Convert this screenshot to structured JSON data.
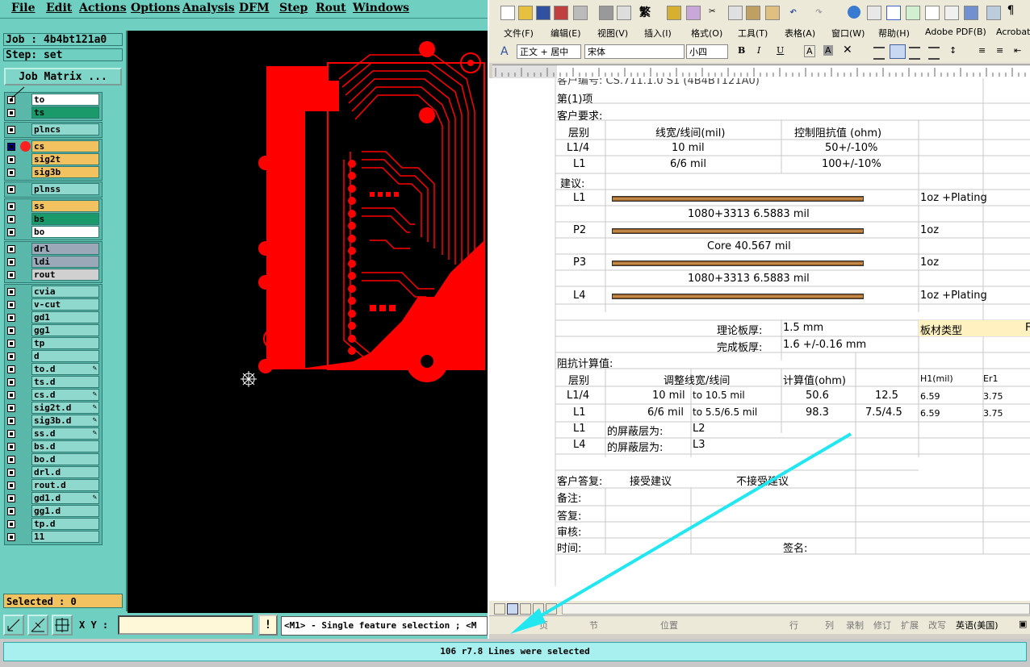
{
  "menu": [
    "File",
    "Edit",
    "Actions",
    "Options",
    "Analysis",
    "DFM",
    "Step",
    "Rout",
    "Windows"
  ],
  "job": {
    "job_label": "Job : 4b4bt121a0",
    "step_label": "Step: set",
    "matrix_button": "Job Matrix ..."
  },
  "layers": [
    {
      "name": "to",
      "color": "#ffffff"
    },
    {
      "name": "ts",
      "color": "#1a9a6a"
    },
    {
      "name": "plncs",
      "color": "#8fd8ce"
    },
    {
      "name": "cs",
      "color": "#f2c260",
      "active": true
    },
    {
      "name": "sig2t",
      "color": "#f2c260"
    },
    {
      "name": "sig3b",
      "color": "#f2c260"
    },
    {
      "name": "plnss",
      "color": "#8fd8ce"
    },
    {
      "name": "ss",
      "color": "#f2c260"
    },
    {
      "name": "bs",
      "color": "#1a9a6a"
    },
    {
      "name": "bo",
      "color": "#ffffff"
    },
    {
      "name": "drl",
      "color": "#9aa8b8"
    },
    {
      "name": "ldi",
      "color": "#9aa8b8"
    },
    {
      "name": "rout",
      "color": "#d0d0d0"
    },
    {
      "name": "cvia",
      "color": "#8fd8ce"
    },
    {
      "name": "v-cut",
      "color": "#8fd8ce"
    },
    {
      "name": "gd1",
      "color": "#8fd8ce"
    },
    {
      "name": "gg1",
      "color": "#8fd8ce"
    },
    {
      "name": "tp",
      "color": "#8fd8ce"
    },
    {
      "name": "d",
      "color": "#8fd8ce"
    },
    {
      "name": "to.d",
      "color": "#8fd8ce",
      "edit": true
    },
    {
      "name": "ts.d",
      "color": "#8fd8ce"
    },
    {
      "name": "cs.d",
      "color": "#8fd8ce",
      "edit": true
    },
    {
      "name": "sig2t.d",
      "color": "#8fd8ce",
      "edit": true
    },
    {
      "name": "sig3b.d",
      "color": "#8fd8ce",
      "edit": true
    },
    {
      "name": "ss.d",
      "color": "#8fd8ce",
      "edit": true
    },
    {
      "name": "bs.d",
      "color": "#8fd8ce"
    },
    {
      "name": "bo.d",
      "color": "#8fd8ce"
    },
    {
      "name": "drl.d",
      "color": "#8fd8ce"
    },
    {
      "name": "rout.d",
      "color": "#8fd8ce"
    },
    {
      "name": "gd1.d",
      "color": "#8fd8ce",
      "edit": true
    },
    {
      "name": "gg1.d",
      "color": "#8fd8ce"
    },
    {
      "name": "tp.d",
      "color": "#8fd8ce"
    },
    {
      "name": "11",
      "color": "#8fd8ce"
    }
  ],
  "selected": "Selected : 0",
  "bottombar": {
    "xy_label": "X Y :",
    "warn": "!",
    "message": "<M1> - Single feature selection ; <M"
  },
  "status": "106 r7.8 Lines were selected",
  "word": {
    "menu": [
      "文件(F)",
      "编辑(E)",
      "视图(V)",
      "插入(I)",
      "格式(O)",
      "工具(T)",
      "表格(A)",
      "窗口(W)",
      "帮助(H)",
      "Adobe PDF(B)",
      "Acrobat"
    ],
    "style_box": "正文 + 居中",
    "font_box": "宋体",
    "size_box": "小四",
    "doc": {
      "top_cut": "客户编号: CS.711.1.0 S1 (4B4BT121A0)",
      "item": "第(1)项",
      "cust_req": "客户要求:",
      "hdr_layer": "层别",
      "hdr_width": "线宽/线间(mil)",
      "hdr_imp": "控制阻抗值 (ohm)",
      "req_rows": [
        {
          "layer": "L1/4",
          "width": "10 mil",
          "imp": "50+/-10%"
        },
        {
          "layer": "L1",
          "width": "6/6 mil",
          "imp": "100+/-10%"
        }
      ],
      "suggest": "建议:",
      "stack": [
        {
          "layer": "L1",
          "cu": "1oz +Plating"
        },
        {
          "note": "1080+3313    6.5883 mil"
        },
        {
          "layer": "P2",
          "cu": "1oz"
        },
        {
          "note": "Core   40.567 mil"
        },
        {
          "layer": "P3",
          "cu": "1oz"
        },
        {
          "note": "1080+3313    6.5883 mil"
        },
        {
          "layer": "L4",
          "cu": "1oz +Plating"
        }
      ],
      "theo_label": "理论板厚:",
      "theo_val": "1.5 mm",
      "mat_label": "板材类型",
      "mat_cut": "F",
      "fin_label": "完成板厚:",
      "fin_val": "1.6 +/-0.16 mm",
      "imp_calc": "阻抗计算值:",
      "calc_hdr": {
        "layer": "层别",
        "adj": "调整线宽/线间",
        "calc": "计算值(ohm)",
        "h1": "H1(mil)",
        "er1": "Er1"
      },
      "calc_rows": [
        {
          "layer": "L1/4",
          "orig": "10 mil",
          "adj": "to  10.5 mil",
          "v1": "50.6",
          "v2": "12.5",
          "h1": "6.59",
          "er1": "3.75"
        },
        {
          "layer": "L1",
          "orig": "6/6 mil",
          "adj": "to  5.5/6.5 mil",
          "v1": "98.3",
          "v2": "7.5/4.5",
          "h1": "6.59",
          "er1": "3.75"
        }
      ],
      "shield_rows": [
        {
          "layer": "L1",
          "text": "的屏蔽层为:",
          "ref": "L2"
        },
        {
          "layer": "L4",
          "text": "的屏蔽层为:",
          "ref": "L3"
        }
      ],
      "reply_label": "客户答复:",
      "accept": "接受建议",
      "reject": "不接受建议",
      "remark": "备注:",
      "answer": "答复:",
      "review": "审核:",
      "time": "时间:",
      "sign": "签名:"
    },
    "status": [
      "页",
      "节",
      "位置",
      "行",
      "列",
      "录制",
      "修订",
      "扩展",
      "改写",
      "英语(美国)"
    ]
  }
}
